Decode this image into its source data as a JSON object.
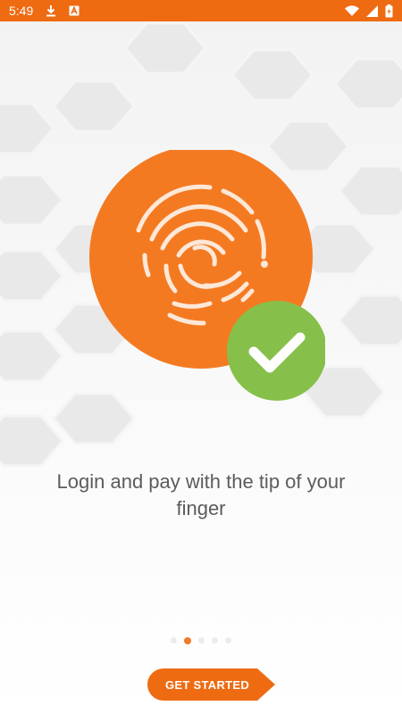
{
  "status_bar": {
    "time": "5:49",
    "left_icons": [
      "download-icon",
      "a-badge-icon"
    ],
    "right_icons": [
      "wifi-icon",
      "signal-icon",
      "battery-charging-icon"
    ]
  },
  "onboarding": {
    "illustration_icons": [
      "fingerprint-icon",
      "checkmark-icon"
    ],
    "tagline": "Login and pay with the tip of your finger",
    "pager": {
      "total": 5,
      "current": 1
    },
    "cta_label": "GET STARTED"
  },
  "colors": {
    "accent": "#ee6b12",
    "illustration_orange": "#f47a22",
    "success_green": "#86c04a",
    "text_gray": "#5c5c5c"
  }
}
